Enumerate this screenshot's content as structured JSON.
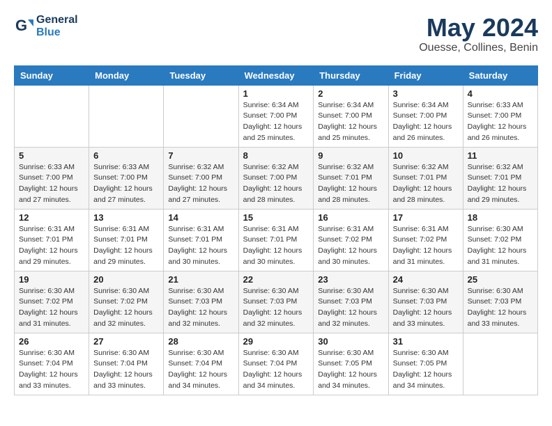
{
  "header": {
    "logo_line1": "General",
    "logo_line2": "Blue",
    "month_title": "May 2024",
    "location": "Ouesse, Collines, Benin"
  },
  "weekdays": [
    "Sunday",
    "Monday",
    "Tuesday",
    "Wednesday",
    "Thursday",
    "Friday",
    "Saturday"
  ],
  "weeks": [
    [
      {
        "day": "",
        "info": ""
      },
      {
        "day": "",
        "info": ""
      },
      {
        "day": "",
        "info": ""
      },
      {
        "day": "1",
        "info": "Sunrise: 6:34 AM\nSunset: 7:00 PM\nDaylight: 12 hours\nand 25 minutes."
      },
      {
        "day": "2",
        "info": "Sunrise: 6:34 AM\nSunset: 7:00 PM\nDaylight: 12 hours\nand 25 minutes."
      },
      {
        "day": "3",
        "info": "Sunrise: 6:34 AM\nSunset: 7:00 PM\nDaylight: 12 hours\nand 26 minutes."
      },
      {
        "day": "4",
        "info": "Sunrise: 6:33 AM\nSunset: 7:00 PM\nDaylight: 12 hours\nand 26 minutes."
      }
    ],
    [
      {
        "day": "5",
        "info": "Sunrise: 6:33 AM\nSunset: 7:00 PM\nDaylight: 12 hours\nand 27 minutes."
      },
      {
        "day": "6",
        "info": "Sunrise: 6:33 AM\nSunset: 7:00 PM\nDaylight: 12 hours\nand 27 minutes."
      },
      {
        "day": "7",
        "info": "Sunrise: 6:32 AM\nSunset: 7:00 PM\nDaylight: 12 hours\nand 27 minutes."
      },
      {
        "day": "8",
        "info": "Sunrise: 6:32 AM\nSunset: 7:00 PM\nDaylight: 12 hours\nand 28 minutes."
      },
      {
        "day": "9",
        "info": "Sunrise: 6:32 AM\nSunset: 7:01 PM\nDaylight: 12 hours\nand 28 minutes."
      },
      {
        "day": "10",
        "info": "Sunrise: 6:32 AM\nSunset: 7:01 PM\nDaylight: 12 hours\nand 28 minutes."
      },
      {
        "day": "11",
        "info": "Sunrise: 6:32 AM\nSunset: 7:01 PM\nDaylight: 12 hours\nand 29 minutes."
      }
    ],
    [
      {
        "day": "12",
        "info": "Sunrise: 6:31 AM\nSunset: 7:01 PM\nDaylight: 12 hours\nand 29 minutes."
      },
      {
        "day": "13",
        "info": "Sunrise: 6:31 AM\nSunset: 7:01 PM\nDaylight: 12 hours\nand 29 minutes."
      },
      {
        "day": "14",
        "info": "Sunrise: 6:31 AM\nSunset: 7:01 PM\nDaylight: 12 hours\nand 30 minutes."
      },
      {
        "day": "15",
        "info": "Sunrise: 6:31 AM\nSunset: 7:01 PM\nDaylight: 12 hours\nand 30 minutes."
      },
      {
        "day": "16",
        "info": "Sunrise: 6:31 AM\nSunset: 7:02 PM\nDaylight: 12 hours\nand 30 minutes."
      },
      {
        "day": "17",
        "info": "Sunrise: 6:31 AM\nSunset: 7:02 PM\nDaylight: 12 hours\nand 31 minutes."
      },
      {
        "day": "18",
        "info": "Sunrise: 6:30 AM\nSunset: 7:02 PM\nDaylight: 12 hours\nand 31 minutes."
      }
    ],
    [
      {
        "day": "19",
        "info": "Sunrise: 6:30 AM\nSunset: 7:02 PM\nDaylight: 12 hours\nand 31 minutes."
      },
      {
        "day": "20",
        "info": "Sunrise: 6:30 AM\nSunset: 7:02 PM\nDaylight: 12 hours\nand 32 minutes."
      },
      {
        "day": "21",
        "info": "Sunrise: 6:30 AM\nSunset: 7:03 PM\nDaylight: 12 hours\nand 32 minutes."
      },
      {
        "day": "22",
        "info": "Sunrise: 6:30 AM\nSunset: 7:03 PM\nDaylight: 12 hours\nand 32 minutes."
      },
      {
        "day": "23",
        "info": "Sunrise: 6:30 AM\nSunset: 7:03 PM\nDaylight: 12 hours\nand 32 minutes."
      },
      {
        "day": "24",
        "info": "Sunrise: 6:30 AM\nSunset: 7:03 PM\nDaylight: 12 hours\nand 33 minutes."
      },
      {
        "day": "25",
        "info": "Sunrise: 6:30 AM\nSunset: 7:03 PM\nDaylight: 12 hours\nand 33 minutes."
      }
    ],
    [
      {
        "day": "26",
        "info": "Sunrise: 6:30 AM\nSunset: 7:04 PM\nDaylight: 12 hours\nand 33 minutes."
      },
      {
        "day": "27",
        "info": "Sunrise: 6:30 AM\nSunset: 7:04 PM\nDaylight: 12 hours\nand 33 minutes."
      },
      {
        "day": "28",
        "info": "Sunrise: 6:30 AM\nSunset: 7:04 PM\nDaylight: 12 hours\nand 34 minutes."
      },
      {
        "day": "29",
        "info": "Sunrise: 6:30 AM\nSunset: 7:04 PM\nDaylight: 12 hours\nand 34 minutes."
      },
      {
        "day": "30",
        "info": "Sunrise: 6:30 AM\nSunset: 7:05 PM\nDaylight: 12 hours\nand 34 minutes."
      },
      {
        "day": "31",
        "info": "Sunrise: 6:30 AM\nSunset: 7:05 PM\nDaylight: 12 hours\nand 34 minutes."
      },
      {
        "day": "",
        "info": ""
      }
    ]
  ]
}
